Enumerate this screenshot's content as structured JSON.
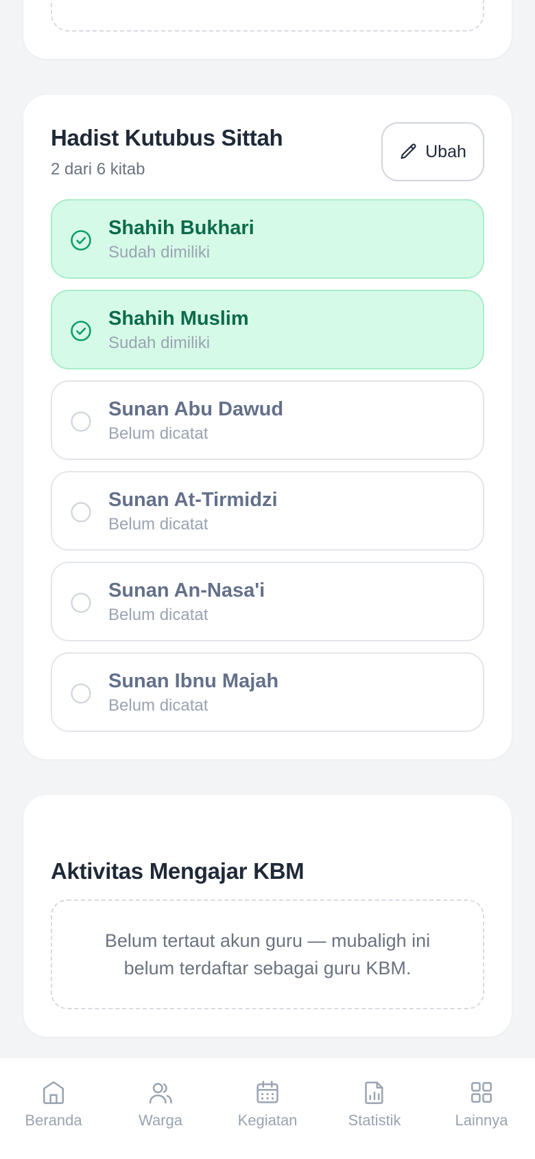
{
  "hadist": {
    "title": "Hadist Kutubus Sittah",
    "subtitle": "2 dari 6 kitab",
    "edit_label": "Ubah",
    "items": [
      {
        "name": "Shahih Bukhari",
        "status": "Sudah dimiliki",
        "owned": true
      },
      {
        "name": "Shahih Muslim",
        "status": "Sudah dimiliki",
        "owned": true
      },
      {
        "name": "Sunan Abu Dawud",
        "status": "Belum dicatat",
        "owned": false
      },
      {
        "name": "Sunan At-Tirmidzi",
        "status": "Belum dicatat",
        "owned": false
      },
      {
        "name": "Sunan An-Nasa'i",
        "status": "Belum dicatat",
        "owned": false
      },
      {
        "name": "Sunan Ibnu Majah",
        "status": "Belum dicatat",
        "owned": false
      }
    ]
  },
  "kbm": {
    "title": "Aktivitas Mengajar KBM",
    "empty_text": "Belum tertaut akun guru — mubaligh ini belum terdaftar sebagai guru KBM."
  },
  "nav": {
    "items": [
      {
        "label": "Beranda",
        "icon": "home-icon"
      },
      {
        "label": "Warga",
        "icon": "users-icon"
      },
      {
        "label": "Kegiatan",
        "icon": "calendar-icon"
      },
      {
        "label": "Statistik",
        "icon": "report-icon"
      },
      {
        "label": "Lainnya",
        "icon": "grid-icon"
      }
    ]
  },
  "colors": {
    "owned_bg": "#d6fae8",
    "owned_border": "#a8edca",
    "owned_text": "#0b6b4b",
    "check_green": "#0f9d6b",
    "muted": "#9aa3b2"
  }
}
